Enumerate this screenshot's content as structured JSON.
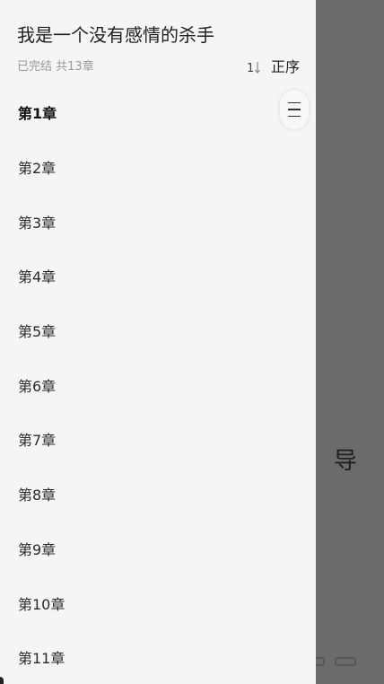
{
  "book": {
    "title": "我是一个没有感情的杀手",
    "status": "已完结",
    "total": "共13章"
  },
  "sort": {
    "icon": "sort-order-icon",
    "label": "正序"
  },
  "chapters": [
    {
      "label": "第1章"
    },
    {
      "label": "第2章"
    },
    {
      "label": "第3章"
    },
    {
      "label": "第4章"
    },
    {
      "label": "第5章"
    },
    {
      "label": "第6章"
    },
    {
      "label": "第7章"
    },
    {
      "label": "第8章"
    },
    {
      "label": "第9章"
    },
    {
      "label": "第10章"
    },
    {
      "label": "第11章"
    }
  ],
  "current_chapter": "第1章",
  "background": {
    "visible_char": "导"
  },
  "colors": {
    "drawer_bg": "#f5f5f5",
    "overlay": "#6b6b6b",
    "meta_text": "#9a9a9a"
  }
}
